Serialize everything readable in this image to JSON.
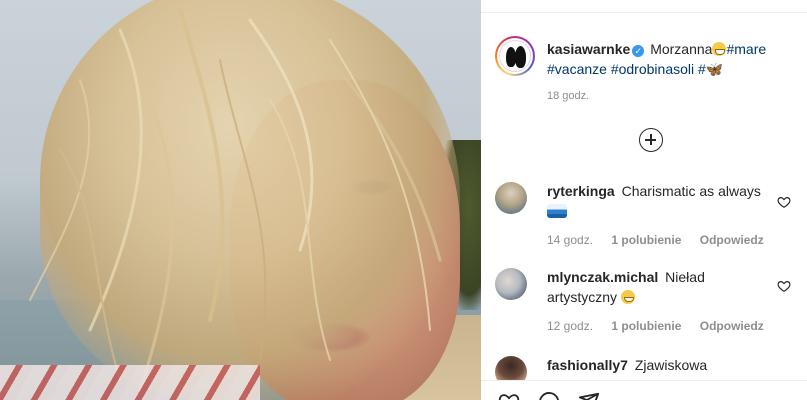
{
  "post": {
    "image_alt": "Selfie of a woman with windblown blonde hair on a beach",
    "author": {
      "username": "kasiawarnke",
      "verified": true
    },
    "caption": {
      "text_before": "Morzanna",
      "tags": [
        "#mare",
        "#vacanze",
        "#odrobinasoli",
        "#"
      ],
      "time": "18 godz."
    },
    "load_more_label": "+"
  },
  "comments": [
    {
      "username": "ryterkinga",
      "text": "Charismatic as always",
      "time": "14 godz.",
      "likes": "1 polubienie",
      "reply": "Odpowiedz"
    },
    {
      "username": "mlynczak.michal",
      "text": "Nieład artystyczny",
      "time": "12 godz.",
      "likes": "1 polubienie",
      "reply": "Odpowiedz"
    },
    {
      "username": "fashionally7",
      "text": "Zjawiskowa",
      "time": "",
      "likes": "",
      "reply": ""
    }
  ],
  "icons": {
    "verified": "verified-badge-icon",
    "add_comments": "plus-circle-icon",
    "like": "heart-icon",
    "comment": "comment-icon",
    "share": "share-icon"
  },
  "colors": {
    "text": "#262626",
    "meta": "#8e8e8e",
    "hashtag": "#00376b",
    "verified": "#3897f0",
    "divider": "#efefef"
  }
}
